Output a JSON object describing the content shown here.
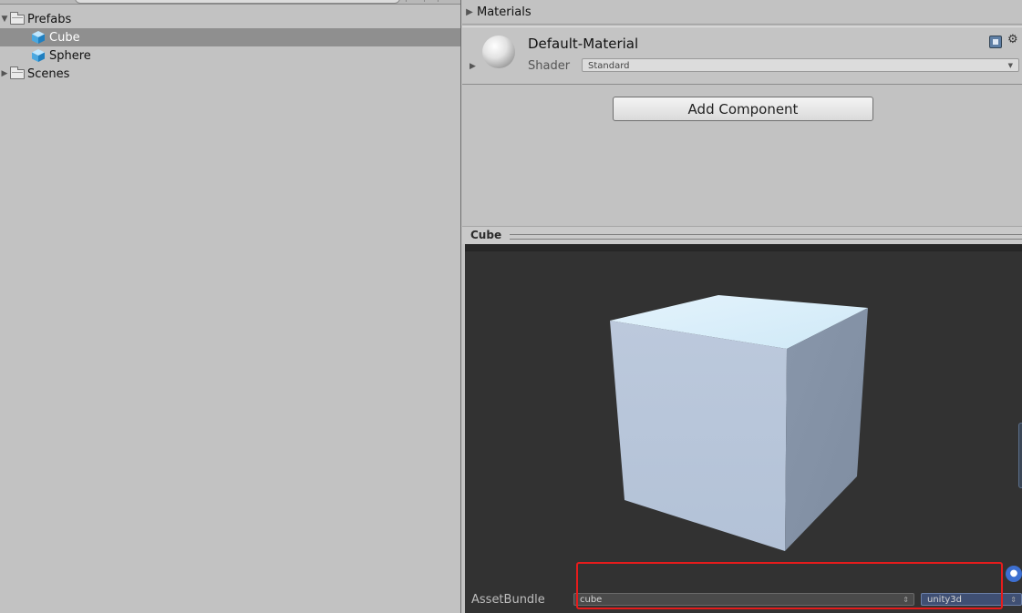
{
  "project": {
    "tree": [
      {
        "label": "Prefabs",
        "expanded": true,
        "icon": "folder-icon"
      },
      {
        "label": "Cube",
        "selected": true,
        "icon": "prefab-cube-icon"
      },
      {
        "label": "Sphere",
        "icon": "prefab-cube-icon"
      },
      {
        "label": "Scenes",
        "expanded": false,
        "icon": "folder-icon"
      }
    ]
  },
  "inspector": {
    "materials_label": "Materials",
    "material": {
      "name": "Default-Material",
      "shader_label": "Shader",
      "shader_value": "Standard"
    },
    "add_component_label": "Add Component"
  },
  "preview": {
    "title": "Cube"
  },
  "assetbundle": {
    "label": "AssetBundle",
    "name_value": "cube",
    "variant_value": "unity3d"
  },
  "colors": {
    "panel": "#c2c2c2",
    "preview_bg": "#323232",
    "highlight": "#e61c1c",
    "selection": "#8f8f8f"
  }
}
